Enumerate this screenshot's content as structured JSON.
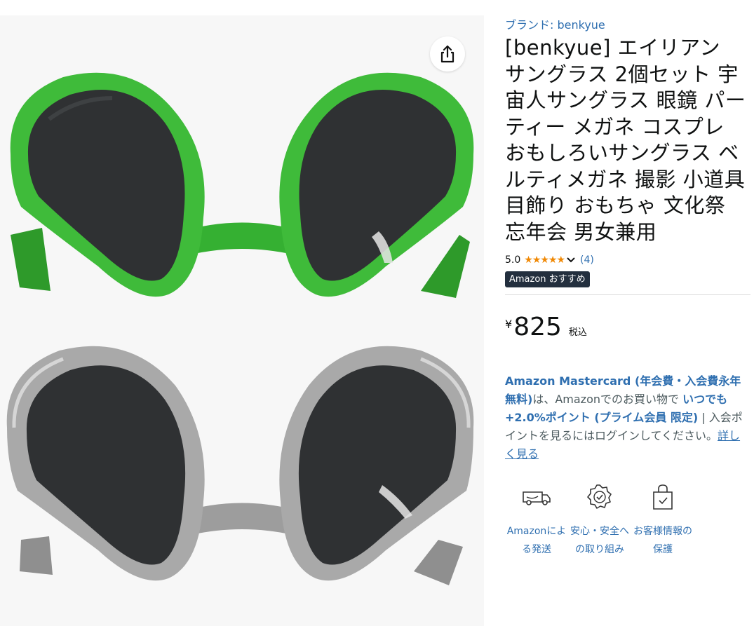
{
  "product": {
    "brand": "ブランド: benkyue",
    "title": "[benkyue] エイリアン サングラス 2個セット 宇宙人サングラス 眼鏡 パーティー メガネ コスプレ おもしろいサングラス ベルティメガネ 撮影 小道具 目飾り おもちゃ 文化祭 忘年会 男女兼用",
    "rating": "5.0",
    "stars": "★★★★★",
    "review_count": "(4)",
    "badge": "Amazon おすすめ",
    "currency": "¥",
    "price": "825",
    "tax_note": "税込"
  },
  "promo": {
    "part1": "Amazon Mastercard (年会費・入会費永年無料)",
    "part2": "は、Amazonでのお買い物で ",
    "part3": "いつでも+2.0%ポイント (プライム会員 限定)",
    "part4": " | 入会ポイントを見るにはログインしてください。",
    "link": "詳しく見る"
  },
  "features": [
    {
      "icon": "delivery-truck-icon",
      "label": "Amazonによる発送"
    },
    {
      "icon": "safety-badge-icon",
      "label": "安心・安全への取り組み"
    },
    {
      "icon": "privacy-bag-icon",
      "label": "お客様情報の保護"
    }
  ],
  "colors": {
    "link": "#2f6fb0",
    "star": "#f08804",
    "badge_bg": "#232f3e",
    "green_frame": "#3fbb3a",
    "silver_frame": "#a9a9a9",
    "lens": "#2f3133"
  }
}
